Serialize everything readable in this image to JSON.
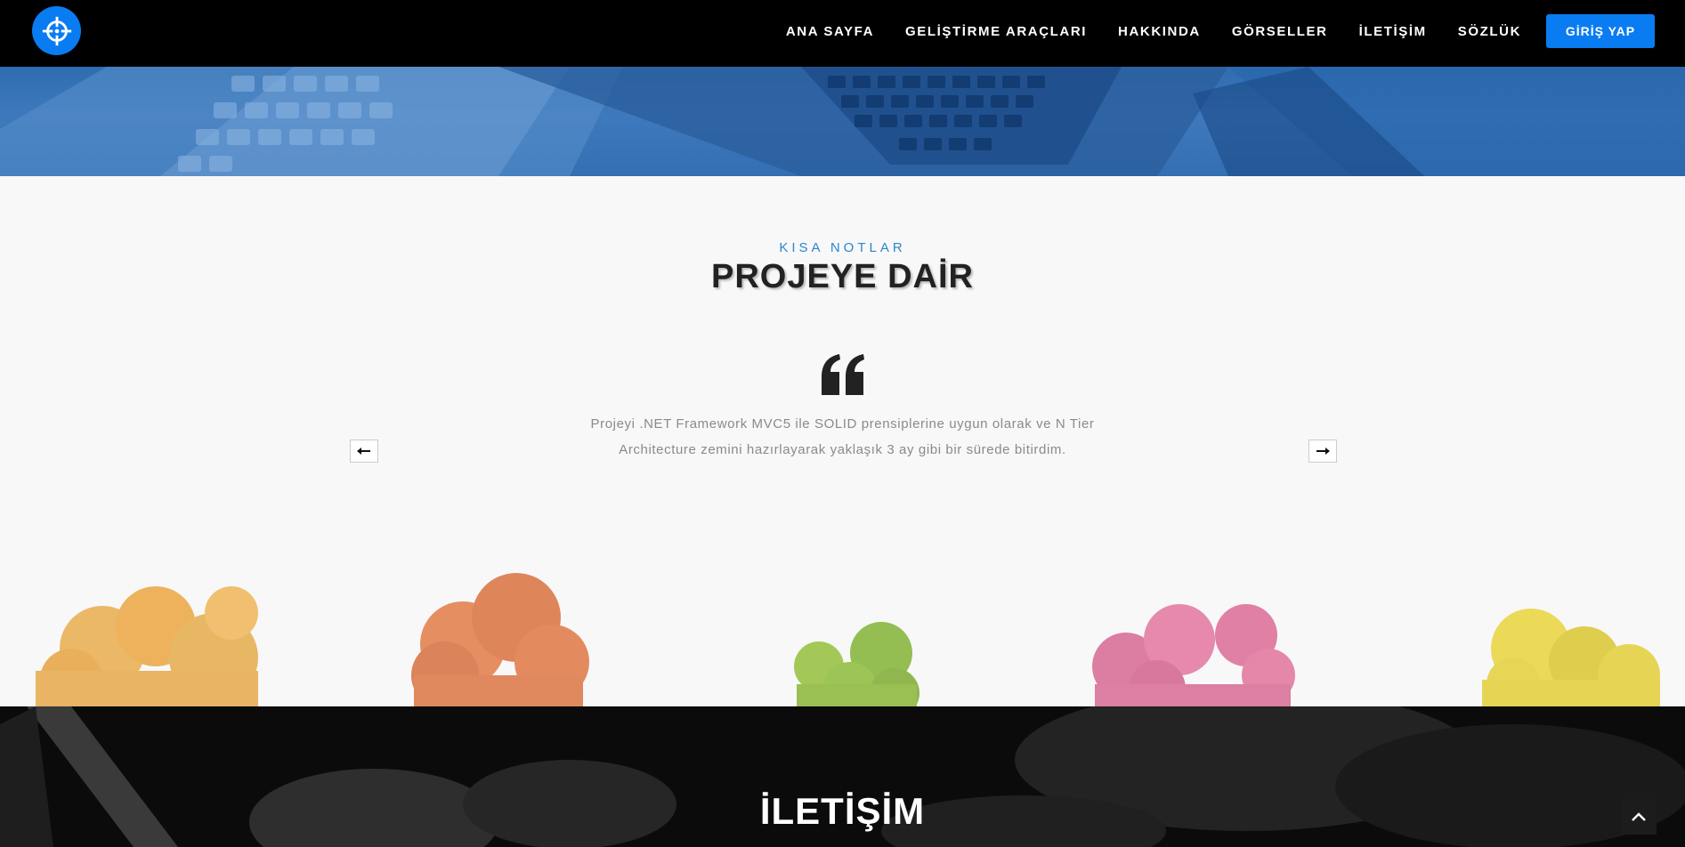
{
  "navbar": {
    "logo_icon": "crosshair-logo-icon",
    "items": [
      {
        "label": "ANA SAYFA"
      },
      {
        "label": "GELİŞTİRME ARAÇLARI"
      },
      {
        "label": "HAKKINDA"
      },
      {
        "label": "GÖRSELLER"
      },
      {
        "label": "İLETİŞİM"
      },
      {
        "label": "SÖZLÜK"
      }
    ],
    "login_label": "GİRİŞ YAP"
  },
  "notes": {
    "subtitle": "KISA NOTLAR",
    "title": "PROJEYE DAİR",
    "quote_icon": "quote-icon",
    "quote_text": "Projeyi .NET Framework MVC5 ile SOLID prensiplerine uygun olarak ve N Tier Architecture zemini hazırlayarak yaklaşık 3 ay gibi bir sürede bitirdim.",
    "prev_icon": "arrow-left-icon",
    "next_icon": "arrow-right-icon"
  },
  "contact": {
    "title": "İLETİŞİM"
  },
  "scroll_top_icon": "chevron-up-icon",
  "colors": {
    "accent": "#0a7cf2",
    "subtitle": "#2a88c9",
    "hero_blue": "#3f79bd"
  }
}
